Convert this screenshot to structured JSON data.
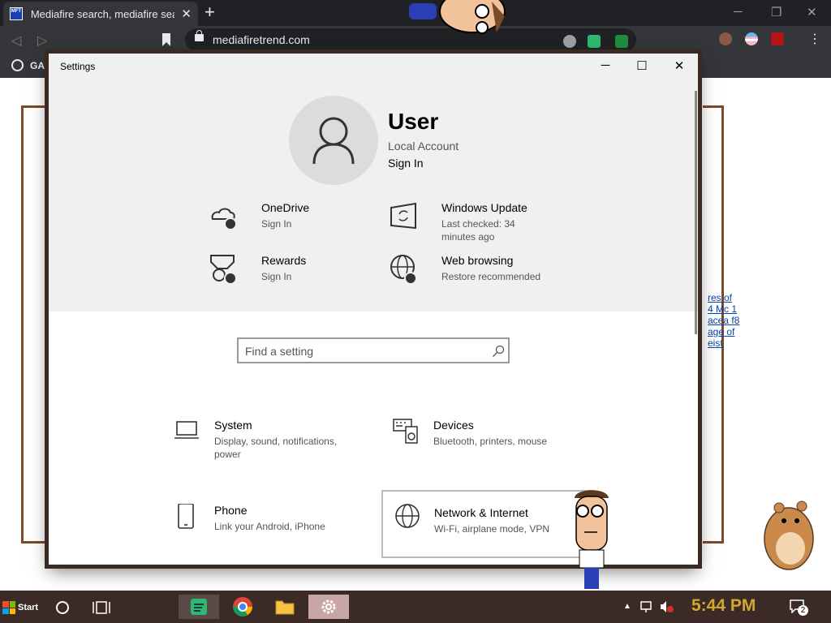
{
  "browser": {
    "tab_title": "Mediafire search, mediafire sea",
    "favicon_text": "MFT",
    "url": "mediafiretrend.com",
    "bookmark_label": "GA"
  },
  "page": {
    "links": [
      "res of",
      "4 Mc 1",
      "acea f8",
      "age of",
      "eist"
    ]
  },
  "settings": {
    "window_title": "Settings",
    "user": {
      "name": "User",
      "account_type": "Local Account",
      "sign_in": "Sign In"
    },
    "quick_items": [
      {
        "title": "OneDrive",
        "subtitle": "Sign In"
      },
      {
        "title": "Windows Update",
        "subtitle": "Last checked: 34 minutes ago"
      },
      {
        "title": "Rewards",
        "subtitle": "Sign In"
      },
      {
        "title": "Web browsing",
        "subtitle": "Restore recommended"
      }
    ],
    "search_placeholder": "Find a setting",
    "categories": [
      {
        "title": "System",
        "subtitle": "Display, sound, notifications, power"
      },
      {
        "title": "Devices",
        "subtitle": "Bluetooth, printers, mouse"
      },
      {
        "title": "Phone",
        "subtitle": "Link your Android, iPhone"
      },
      {
        "title": "Network & Internet",
        "subtitle": "Wi-Fi, airplane mode, VPN"
      }
    ]
  },
  "taskbar": {
    "start_label": "Start",
    "clock": "5:44 PM",
    "notification_count": "2"
  },
  "colors": {
    "accent_clock": "#d4a62a",
    "taskbar_bg": "#3c2a26"
  }
}
